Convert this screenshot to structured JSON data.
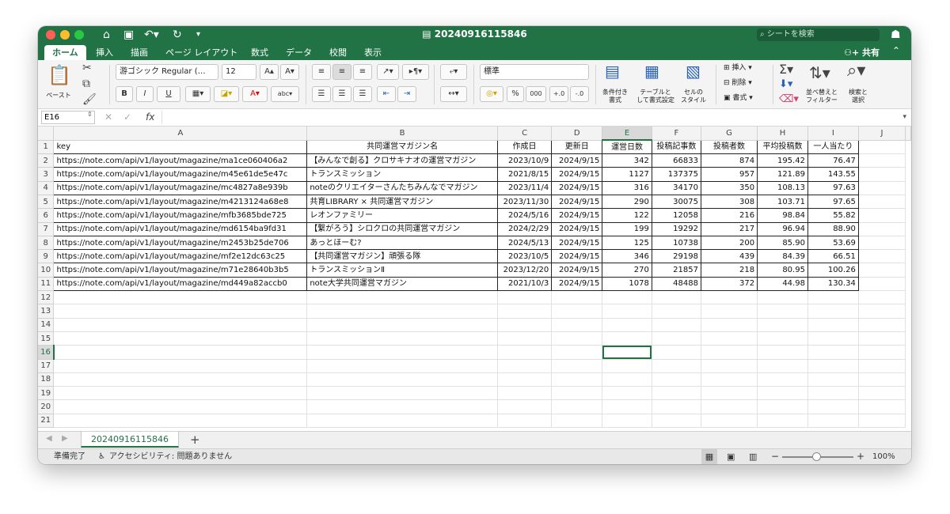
{
  "window": {
    "title": "20240916115846",
    "search_placeholder": "シートを検索",
    "share_label": "共有"
  },
  "tabs": [
    "ホーム",
    "挿入",
    "描画",
    "ページ レイアウト",
    "数式",
    "データ",
    "校閲",
    "表示"
  ],
  "ribbon": {
    "paste_label": "ペースト",
    "font_name": "游ゴシック Regular (…",
    "font_size": "12",
    "number_format": "標準",
    "conditional_label": [
      "条件付き",
      "書式"
    ],
    "table_format_label": [
      "テーブルと",
      "して書式設定"
    ],
    "cell_style_label": [
      "セルの",
      "スタイル"
    ],
    "insert_label": "挿入",
    "delete_label": "削除",
    "format_label": "書式",
    "sort_label": [
      "並べ替えと",
      "フィルター"
    ],
    "find_label": [
      "検索と",
      "選択"
    ],
    "bold": "B",
    "italic": "I",
    "underline": "U"
  },
  "formula_bar": {
    "name_box": "E16",
    "fx": "fx",
    "value": ""
  },
  "columns": [
    "A",
    "B",
    "C",
    "D",
    "E",
    "F",
    "G",
    "H",
    "I",
    "J"
  ],
  "selected_column": "E",
  "selected_row": 16,
  "header_row": [
    "key",
    "共同運営マガジン名",
    "作成日",
    "更新日",
    "運営日数",
    "投稿記事数",
    "投稿者数",
    "平均投稿数",
    "一人当たり"
  ],
  "rows": [
    [
      "https://note.com/api/v1/layout/magazine/ma1ce060406a2",
      "【みんなで創る】クロサキナオの運営マガジン",
      "2023/10/9",
      "2024/9/15",
      "342",
      "66833",
      "874",
      "195.42",
      "76.47"
    ],
    [
      "https://note.com/api/v1/layout/magazine/m45e61de5e47c",
      "トランスミッション",
      "2021/8/15",
      "2024/9/15",
      "1127",
      "137375",
      "957",
      "121.89",
      "143.55"
    ],
    [
      "https://note.com/api/v1/layout/magazine/mc4827a8e939b",
      "noteのクリエイターさんたちみんなでマガジン",
      "2023/11/4",
      "2024/9/15",
      "316",
      "34170",
      "350",
      "108.13",
      "97.63"
    ],
    [
      "https://note.com/api/v1/layout/magazine/m4213124a68e8",
      "共育LIBRARY × 共同運営マガジン",
      "2023/11/30",
      "2024/9/15",
      "290",
      "30075",
      "308",
      "103.71",
      "97.65"
    ],
    [
      "https://note.com/api/v1/layout/magazine/mfb3685bde725",
      "レオンファミリー",
      "2024/5/16",
      "2024/9/15",
      "122",
      "12058",
      "216",
      "98.84",
      "55.82"
    ],
    [
      "https://note.com/api/v1/layout/magazine/md6154ba9fd31",
      "【繋がろう】シロクロの共同運営マガジン",
      "2024/2/29",
      "2024/9/15",
      "199",
      "19292",
      "217",
      "96.94",
      "88.90"
    ],
    [
      "https://note.com/api/v1/layout/magazine/m2453b25de706",
      "あっとほーむ?",
      "2024/5/13",
      "2024/9/15",
      "125",
      "10738",
      "200",
      "85.90",
      "53.69"
    ],
    [
      "https://note.com/api/v1/layout/magazine/mf2e12dc63c25",
      "【共同運営マガジン】頑張る隊",
      "2023/10/5",
      "2024/9/15",
      "346",
      "29198",
      "439",
      "84.39",
      "66.51"
    ],
    [
      "https://note.com/api/v1/layout/magazine/m71e28640b3b5",
      "トランスミッションⅡ",
      "2023/12/20",
      "2024/9/15",
      "270",
      "21857",
      "218",
      "80.95",
      "100.26"
    ],
    [
      "https://note.com/api/v1/layout/magazine/md449a82accb0",
      "note大学共同運営マガジン",
      "2021/10/3",
      "2024/9/15",
      "1078",
      "48488",
      "372",
      "44.98",
      "130.34"
    ]
  ],
  "empty_rows": [
    12,
    13,
    14,
    15,
    16,
    17,
    18,
    19,
    20,
    21
  ],
  "sheet_tab": "20240916115846",
  "status": {
    "ready": "準備完了",
    "accessibility": "アクセシビリティ: 問題ありません",
    "zoom": "100%"
  },
  "colors": {
    "accent": "#217346"
  }
}
